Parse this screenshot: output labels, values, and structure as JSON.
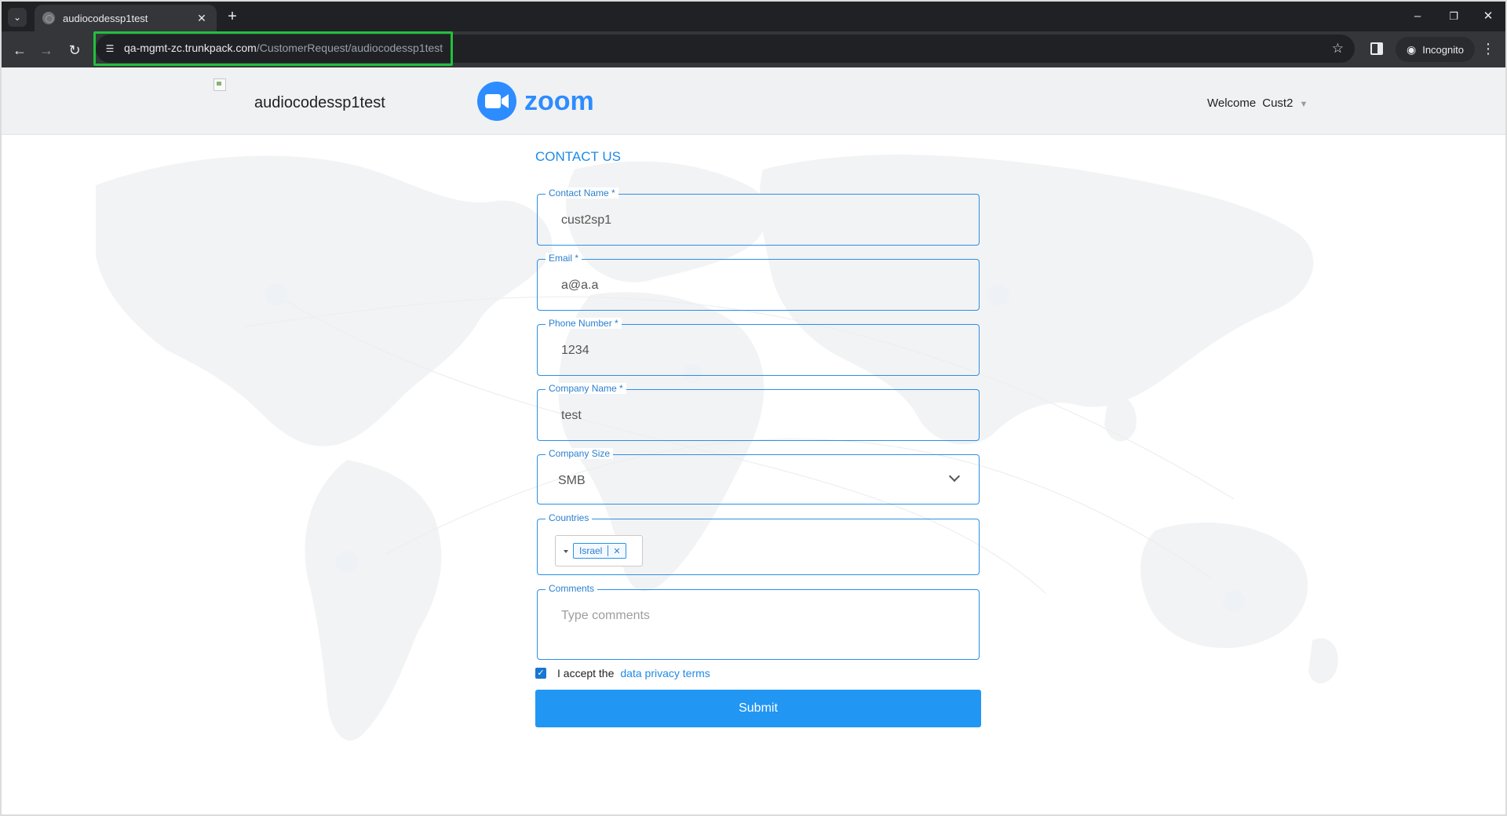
{
  "browser": {
    "tab_title": "audiocodessp1test",
    "url_host": "qa-mgmt-zc.trunkpack.com",
    "url_path": "/CustomerRequest/audiocodessp1test",
    "incognito_label": "Incognito"
  },
  "header": {
    "tenant_name": "audiocodessp1test",
    "brand_wordmark": "zoom",
    "welcome_label": "Welcome",
    "user_name": "Cust2"
  },
  "form": {
    "title": "CONTACT US",
    "contact_name": {
      "label": "Contact Name *",
      "value": "cust2sp1"
    },
    "email": {
      "label": "Email *",
      "value": "a@a.a"
    },
    "phone_number": {
      "label": "Phone Number *",
      "value": "1234"
    },
    "company_name": {
      "label": "Company Name *",
      "value": "test"
    },
    "company_size": {
      "label": "Company Size",
      "value": "SMB"
    },
    "countries": {
      "label": "Countries",
      "selected": [
        "Israel"
      ]
    },
    "comments": {
      "label": "Comments",
      "placeholder": "Type comments"
    },
    "consent": {
      "text": "I accept the",
      "link": "data privacy terms",
      "checked": true
    },
    "submit_label": "Submit"
  },
  "colors": {
    "accent": "#2196f3",
    "label_blue": "#2b7fcf",
    "url_highlight": "#22c03c",
    "browser_dark": "#202124"
  }
}
